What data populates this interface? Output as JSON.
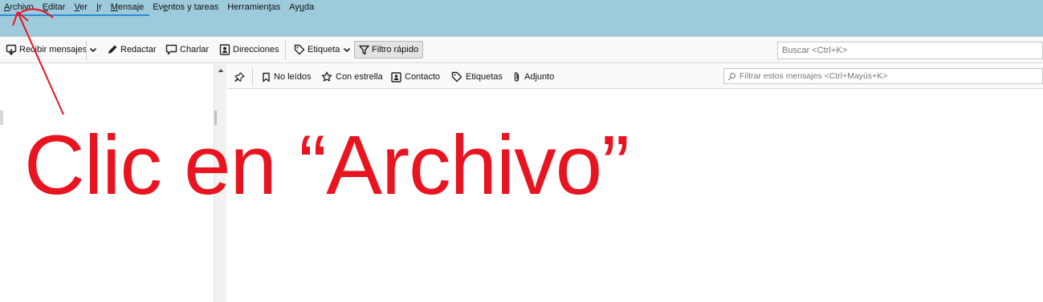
{
  "menu": [
    {
      "pre": "",
      "acc": "A",
      "post": "rchivo"
    },
    {
      "pre": "",
      "acc": "E",
      "post": "ditar"
    },
    {
      "pre": "",
      "acc": "V",
      "post": "er"
    },
    {
      "pre": "",
      "acc": "I",
      "post": "r"
    },
    {
      "pre": "",
      "acc": "M",
      "post": "ensaje"
    },
    {
      "pre": "Ev",
      "acc": "e",
      "post": "ntos y tareas"
    },
    {
      "pre": "Herramien",
      "acc": "t",
      "post": "as"
    },
    {
      "pre": "Ay",
      "acc": "u",
      "post": "da"
    }
  ],
  "toolbar": {
    "get_messages": "Recibir mensajes",
    "write": "Redactar",
    "chat": "Charlar",
    "address_book": "Direcciones",
    "tag": "Etiqueta",
    "quick_filter": "Filtro rápido",
    "search_placeholder": "Buscar <Ctrl+K>"
  },
  "quick_filter": {
    "unread": "No leídos",
    "starred": "Con estrella",
    "contact": "Contacto",
    "tags": "Etiquetas",
    "attachment": "Adjunto",
    "filter_placeholder": "Filtrar estos mensajes <Ctrl+Mayús+K>"
  },
  "annotation": {
    "text": "Clic en “Archivo”",
    "color": "#e8141f"
  },
  "colors": {
    "menubar_bg": "#9dcbdc",
    "accent": "#2b8cd6"
  },
  "icons": [
    "get-messages-icon",
    "chevron-down-icon",
    "pencil-icon",
    "chat-bubble-icon",
    "address-book-icon",
    "tag-icon",
    "funnel-icon",
    "pin-icon",
    "bookmark-icon",
    "star-icon",
    "contact-card-icon",
    "tags-icon",
    "paperclip-icon",
    "search-icon",
    "scroll-up-icon"
  ]
}
